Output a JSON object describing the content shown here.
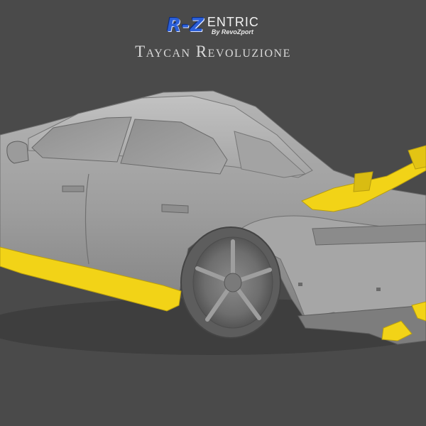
{
  "logo": {
    "mark": "R-Z",
    "wordmark": "ENTRIC",
    "subtitle": "By RevoZport",
    "mark_color": "#2b5fd8"
  },
  "title": "Taycan Revoluzione",
  "colors": {
    "background": "#4a4a4a",
    "body": "#9a9a9a",
    "parts": "#f2d317"
  }
}
